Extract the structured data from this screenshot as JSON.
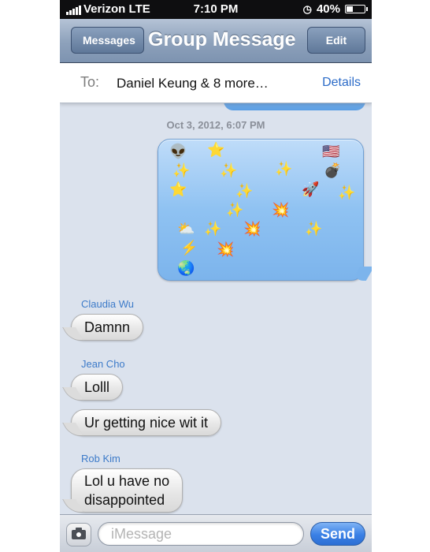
{
  "status_bar": {
    "carrier": "Verizon  LTE",
    "time": "7:10 PM",
    "battery": "40%",
    "battery_level": 0.4
  },
  "nav": {
    "back_label": "Messages",
    "title": "Group Message",
    "edit_label": "Edit"
  },
  "to_bar": {
    "label": "To:",
    "recipients": "Daniel Keung & 8 more…",
    "details_label": "Details"
  },
  "conversation": {
    "timestamp": "Oct 3, 2012, 6:07 PM",
    "emoji_message": {
      "emoji": [
        "👽",
        "⭐",
        "🇺🇸",
        "✨",
        "✨",
        "✨",
        "💣",
        "⭐",
        "✨",
        "🚀",
        "✨",
        "✨",
        "💥",
        "⛅",
        "✨",
        "💥",
        "✨",
        "⚡",
        "💥",
        "🌏"
      ]
    },
    "messages": [
      {
        "sender": "Claudia Wu",
        "text": "Damnn"
      },
      {
        "sender": "Jean Cho",
        "text": "Lolll"
      },
      {
        "sender": "",
        "text": "Ur getting nice wit it"
      },
      {
        "sender": "Rob Kim",
        "line1": "Lol u have no",
        "line2": "disappointed"
      }
    ]
  },
  "input_bar": {
    "placeholder": "iMessage",
    "send_label": "Send"
  }
}
